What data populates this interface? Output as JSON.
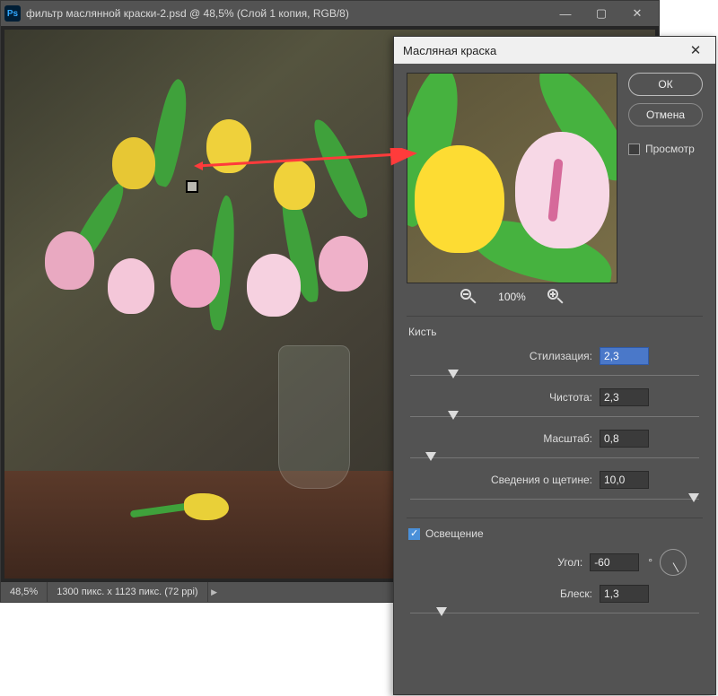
{
  "window": {
    "title": "фильтр маслянной краски-2.psd @ 48,5% (Слой 1 копия, RGB/8)",
    "logo": "Ps"
  },
  "statusbar": {
    "zoom": "48,5%",
    "docinfo": "1300 пикс. x 1123 пикс. (72 ppi)"
  },
  "dialog": {
    "title": "Масляная краска",
    "ok": "ОК",
    "cancel": "Отмена",
    "preview_label": "Просмотр",
    "preview_checked": false,
    "zoom": "100%",
    "brush_section": "Кисть",
    "stylization_label": "Стилизация:",
    "stylization_value": "2,3",
    "cleanliness_label": "Чистота:",
    "cleanliness_value": "2,3",
    "scale_label": "Масштаб:",
    "scale_value": "0,8",
    "bristle_label": "Сведения о щетине:",
    "bristle_value": "10,0",
    "lighting_section": "Освещение",
    "lighting_checked": true,
    "angle_label": "Угол:",
    "angle_value": "-60",
    "shine_label": "Блеск:",
    "shine_value": "1,3"
  }
}
